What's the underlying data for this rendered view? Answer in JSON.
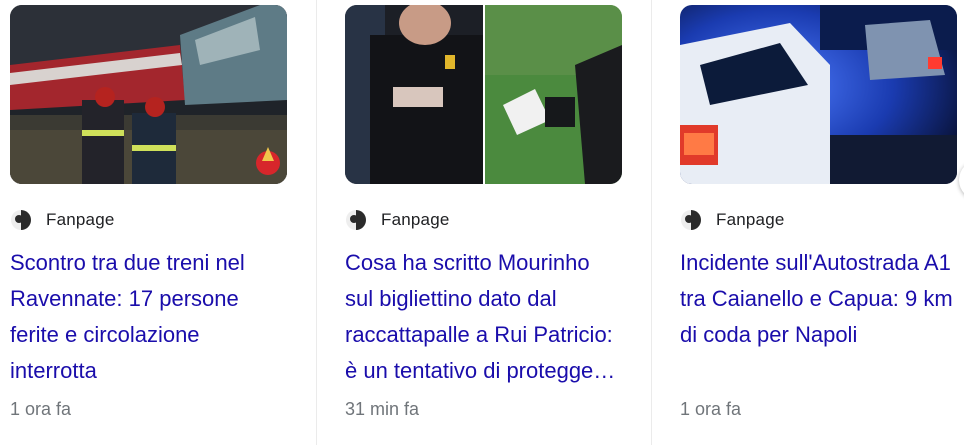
{
  "articles": [
    {
      "source": "Fanpage",
      "headline": "Scontro tra due treni nel Ravennate: 17 persone ferite e circolazione interrotta",
      "time": "1 ora fa"
    },
    {
      "source": "Fanpage",
      "headline": "Cosa ha scritto Mourinho sul bigliettino dato dal raccattapalle a Rui Patricio: è un tentativo di proteggere l'Atalanta dall'Inter",
      "time": "31 min fa"
    },
    {
      "source": "Fanpage",
      "headline": "Incidente sull'Autostrada A1 tra Caianello e Capua: 9 km di coda per Napoli",
      "time": "1 ora fa"
    }
  ],
  "icons": {
    "source_icon": "fanpage-logo-icon",
    "next_icon": "chevron-right-icon"
  },
  "colors": {
    "headline": "#1a0dab",
    "meta": "#70757a",
    "source": "#202124"
  }
}
